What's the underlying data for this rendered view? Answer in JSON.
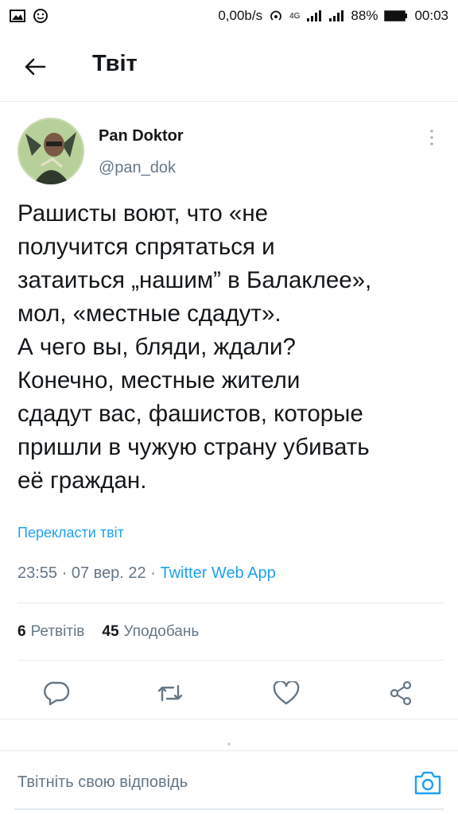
{
  "status_bar": {
    "speed": "0,00b/s",
    "network": "4G",
    "battery": "88%",
    "time": "00:03",
    "icons": [
      "image-icon",
      "smiley-icon",
      "hotspot-icon",
      "signal-icon",
      "signal-icon",
      "battery-icon"
    ]
  },
  "header": {
    "title": "Твіт",
    "back_icon": "arrow-left-icon"
  },
  "tweet": {
    "author_name": "Pan Doktor",
    "author_handle": "@pan_dok",
    "text": "Рашисты воют, что «не\nполучится спрятаться и\nзатаиться „нашим” в Балаклее»,\nмол, «местные сдадут».\nА чего вы, бляди, ждали?\nКонечно, местные жители\nсдадут вас, фашистов, которые\nпришли в чужую страну убивать\nеё граждан.",
    "translate": "Перекласти твіт",
    "time": "23:55",
    "date": "07 вер. 22",
    "separator": "·",
    "source": "Twitter Web App"
  },
  "stats": {
    "retweets_count": "6",
    "retweets_label": "Ретвітів",
    "likes_count": "45",
    "likes_label": "Уподобань"
  },
  "actions": [
    "reply-icon",
    "retweet-icon",
    "like-icon",
    "share-icon"
  ],
  "reply": {
    "placeholder": "Твітніть свою відповідь",
    "camera_icon": "camera-icon"
  },
  "colors": {
    "accent": "#1da1f2",
    "text": "#14171a",
    "secondary": "#657786",
    "divider": "#e6ecf0"
  }
}
